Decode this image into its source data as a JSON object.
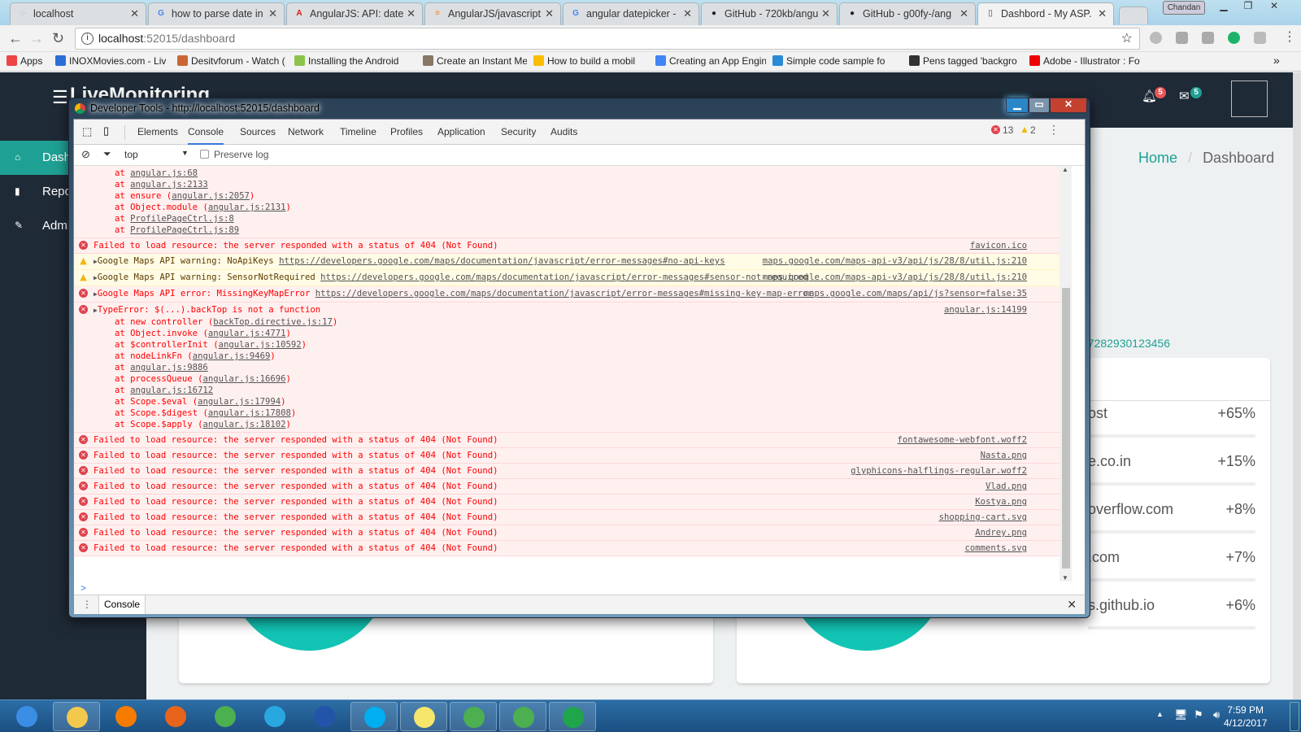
{
  "browser": {
    "tabs": [
      {
        "label": "localhost",
        "icon": "loading-icon"
      },
      {
        "label": "how to parse date in",
        "icon": "google-icon"
      },
      {
        "label": "AngularJS: API: date",
        "icon": "angular-icon"
      },
      {
        "label": "AngularJS/javascript",
        "icon": "stackoverflow-icon"
      },
      {
        "label": "angular datepicker -",
        "icon": "google-icon"
      },
      {
        "label": "GitHub - 720kb/angu",
        "icon": "github-icon"
      },
      {
        "label": "GitHub - g00fy-/ang",
        "icon": "github-icon"
      },
      {
        "label": "Dashbord - My ASP.",
        "icon": "page-icon",
        "active": true
      }
    ],
    "profile": "Chandan",
    "url_host": "localhost",
    "url_path": ":52015/dashboard",
    "bookmarks": [
      "Apps",
      "INOXMovies.com - Liv",
      "Desitvforum - Watch (",
      "Installing the Android",
      "Create an Instant Mes",
      "How to build a mobil",
      "Creating an App Engin",
      "Simple code sample fo",
      "Pens tagged 'backgro",
      "Adobe - Illustrator : Fo"
    ],
    "more_bookmarks": "»"
  },
  "app": {
    "brand": "LiveMonitoring",
    "notifications_count": "5",
    "messages_count": "5",
    "sidebar": [
      {
        "label": "Dashboard",
        "icon": "home-icon"
      },
      {
        "label": "Reports",
        "icon": "bar-chart-icon"
      },
      {
        "label": "Admin",
        "icon": "edit-icon"
      }
    ],
    "breadcrumb": {
      "home": "Home",
      "sep": "/",
      "current": "Dashboard"
    },
    "number_text": "27282930123456",
    "referrers": [
      {
        "name": "ost",
        "pct": "+65%"
      },
      {
        "name": "e.co.in",
        "pct": "+15%"
      },
      {
        "name": "overflow.com",
        "pct": "+8%"
      },
      {
        "name": ".com",
        "pct": "+7%"
      },
      {
        "name": "s.github.io",
        "pct": "+6%"
      }
    ],
    "accent": "#1fa094"
  },
  "devtools": {
    "title": "Developer Tools - http://localhost:52015/dashboard",
    "tabs": [
      "Elements",
      "Console",
      "Sources",
      "Network",
      "Timeline",
      "Profiles",
      "Application",
      "Security",
      "Audits"
    ],
    "active_tab": "Console",
    "error_count": "13",
    "warning_count": "2",
    "context": "top",
    "preserve_log": "Preserve log",
    "drawer_tab": "Console",
    "messages": [
      {
        "type": "stack-only",
        "stack": [
          {
            "fn": "",
            "link": "angular.js:68"
          },
          {
            "fn": "",
            "link": "angular.js:2133"
          },
          {
            "fn": "ensure",
            "link": "angular.js:2057"
          },
          {
            "fn": "Object.module",
            "link": "angular.js:2131"
          },
          {
            "fn": "",
            "link": "ProfilePageCtrl.js:8"
          },
          {
            "fn": "",
            "link": "ProfilePageCtrl.js:89"
          }
        ]
      },
      {
        "type": "err",
        "text": "Failed to load resource: the server responded with a status of 404 (Not Found)",
        "source": "favicon.ico"
      },
      {
        "type": "warn",
        "expand": true,
        "text": "Google Maps API warning: NoApiKeys ",
        "link": "https://developers.google.com/maps/documentation/javascript/error-messages#no-api-keys",
        "source": "maps.google.com/maps-api-v3/api/js/28/8/util.js:210"
      },
      {
        "type": "warn",
        "expand": true,
        "text": "Google Maps API warning: SensorNotRequired ",
        "link": "https://developers.google.com/maps/documentation/javascript/error-messages#sensor-not-required",
        "source": "maps.google.com/maps-api-v3/api/js/28/8/util.js:210"
      },
      {
        "type": "err",
        "expand": true,
        "text": "Google Maps API error: MissingKeyMapError ",
        "link": "https://developers.google.com/maps/documentation/javascript/error-messages#missing-key-map-error",
        "source": "maps.google.com/maps/api/js?sensor=false:35"
      },
      {
        "type": "err",
        "expand": true,
        "text": "TypeError: $(...).backTop is not a function",
        "source": "angular.js:14199",
        "stack": [
          {
            "fn": "new controller",
            "link": "backTop.directive.js:17"
          },
          {
            "fn": "Object.invoke",
            "link": "angular.js:4771"
          },
          {
            "fn": "$controllerInit",
            "link": "angular.js:10592"
          },
          {
            "fn": "nodeLinkFn",
            "link": "angular.js:9469"
          },
          {
            "fn": "",
            "link": "angular.js:9886"
          },
          {
            "fn": "processQueue",
            "link": "angular.js:16696"
          },
          {
            "fn": "",
            "link": "angular.js:16712"
          },
          {
            "fn": "Scope.$eval",
            "link": "angular.js:17994"
          },
          {
            "fn": "Scope.$digest",
            "link": "angular.js:17808"
          },
          {
            "fn": "Scope.$apply",
            "link": "angular.js:18102"
          }
        ]
      },
      {
        "type": "err",
        "text": "Failed to load resource: the server responded with a status of 404 (Not Found)",
        "source": "fontawesome-webfont.woff2"
      },
      {
        "type": "err",
        "text": "Failed to load resource: the server responded with a status of 404 (Not Found)",
        "source": "Nasta.png"
      },
      {
        "type": "err",
        "text": "Failed to load resource: the server responded with a status of 404 (Not Found)",
        "source": "glyphicons-halflings-regular.woff2"
      },
      {
        "type": "err",
        "text": "Failed to load resource: the server responded with a status of 404 (Not Found)",
        "source": "Vlad.png"
      },
      {
        "type": "err",
        "text": "Failed to load resource: the server responded with a status of 404 (Not Found)",
        "source": "Kostya.png"
      },
      {
        "type": "err",
        "text": "Failed to load resource: the server responded with a status of 404 (Not Found)",
        "source": "shopping-cart.svg"
      },
      {
        "type": "err",
        "text": "Failed to load resource: the server responded with a status of 404 (Not Found)",
        "source": "Andrey.png"
      },
      {
        "type": "err",
        "text": "Failed to load resource: the server responded with a status of 404 (Not Found)",
        "source": "comments.svg"
      }
    ],
    "prompt": ">"
  },
  "taskbar": {
    "apps": [
      "start",
      "explorer",
      "media-player",
      "firefox",
      "chrome",
      "internet-explorer",
      "remote-desktop",
      "skype",
      "sticky-notes",
      "chrome",
      "chrome",
      "visual-studio"
    ],
    "time": "7:59 PM",
    "date": "4/12/2017"
  }
}
